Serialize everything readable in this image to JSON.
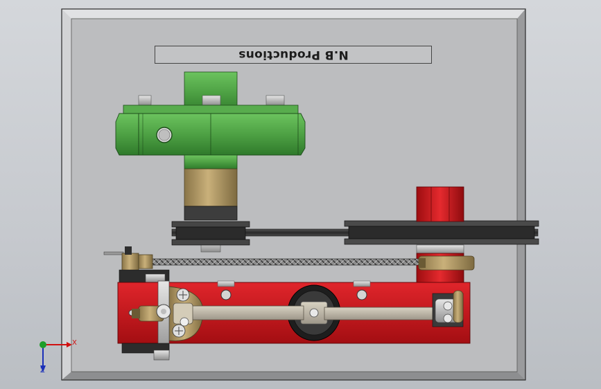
{
  "viewport": {
    "plate_label": "N.B Productions",
    "triad": {
      "x_label": "X",
      "z_label": "Z"
    }
  },
  "colors": {
    "background": "#c9cdd2",
    "base_plate": "#bdbec0",
    "green_part": "#4a9e42",
    "brass_part": "#b19a64",
    "red_part": "#c8141a",
    "dark_part": "#3a3a3a"
  },
  "icons": [
    "coordinate-triad-icon"
  ]
}
